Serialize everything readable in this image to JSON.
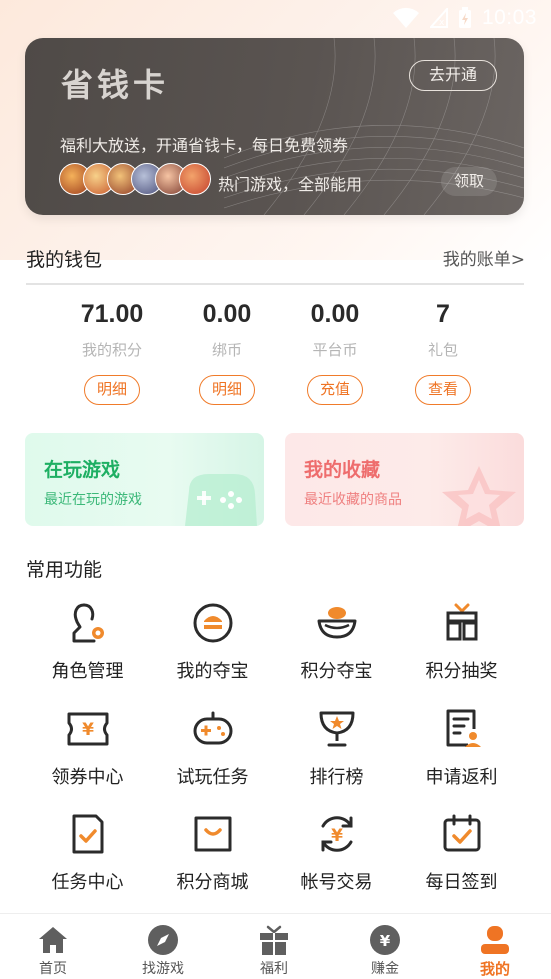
{
  "status_bar": {
    "time": "10:03"
  },
  "savings_card": {
    "title": "省钱卡",
    "open_button": "去开通",
    "description": "福利大放送，开通省钱卡，每日免费领券",
    "hot_games_text": "热门游戏，全部能用",
    "claim_button": "领取"
  },
  "wallet": {
    "title": "我的钱包",
    "bill_link": "我的账单>",
    "items": [
      {
        "value": "71.00",
        "label": "我的积分",
        "button": "明细"
      },
      {
        "value": "0.00",
        "label": "绑币",
        "button": "明细"
      },
      {
        "value": "0.00",
        "label": "平台币",
        "button": "充值"
      },
      {
        "value": "7",
        "label": "礼包",
        "button": "查看"
      }
    ]
  },
  "tiles": {
    "playing": {
      "title": "在玩游戏",
      "subtitle": "最近在玩的游戏"
    },
    "favorites": {
      "title": "我的收藏",
      "subtitle": "最近收藏的商品"
    }
  },
  "functions": {
    "title": "常用功能",
    "items": [
      {
        "label": "角色管理",
        "icon": "role-manage-icon"
      },
      {
        "label": "我的夺宝",
        "icon": "my-treasure-icon"
      },
      {
        "label": "积分夺宝",
        "icon": "points-treasure-icon"
      },
      {
        "label": "积分抽奖",
        "icon": "points-lottery-icon"
      },
      {
        "label": "领券中心",
        "icon": "coupon-icon"
      },
      {
        "label": "试玩任务",
        "icon": "gamepad-icon"
      },
      {
        "label": "排行榜",
        "icon": "trophy-icon"
      },
      {
        "label": "申请返利",
        "icon": "rebate-icon"
      },
      {
        "label": "任务中心",
        "icon": "task-icon"
      },
      {
        "label": "积分商城",
        "icon": "shop-icon"
      },
      {
        "label": "帐号交易",
        "icon": "trade-icon"
      },
      {
        "label": "每日签到",
        "icon": "checkin-icon"
      }
    ]
  },
  "bottom_nav": {
    "items": [
      {
        "label": "首页",
        "icon": "home-icon"
      },
      {
        "label": "找游戏",
        "icon": "compass-icon"
      },
      {
        "label": "福利",
        "icon": "gift-icon"
      },
      {
        "label": "赚金",
        "icon": "money-bag-icon"
      },
      {
        "label": "我的",
        "icon": "user-icon",
        "active": true
      }
    ]
  },
  "colors": {
    "accent": "#ef7424",
    "card_bg": "#554f4c",
    "green": "#1eaf63",
    "red": "#ee6d6d"
  }
}
